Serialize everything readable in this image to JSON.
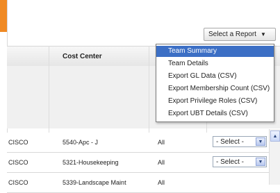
{
  "toolbar": {
    "report_button_label": "Select a Report",
    "caret": "▼"
  },
  "table": {
    "header": {
      "cost_center": "Cost Center"
    },
    "rows": [
      {
        "col1": "CISCO",
        "cost_center": "5540-Apc - J",
        "scope": "All",
        "select_value": "- Select -"
      },
      {
        "col1": "CISCO",
        "cost_center": "5321-Housekeeping",
        "scope": "All",
        "select_value": "- Select -"
      },
      {
        "col1": "CISCO",
        "cost_center": "5339-Landscape Maint",
        "scope": "All"
      }
    ]
  },
  "report_menu": {
    "items": [
      "Team Summary",
      "Team Details",
      "Export GL Data (CSV)",
      "Export Membership Count (CSV)",
      "Export Privilege Roles (CSV)",
      "Export UBT Details (CSV)"
    ],
    "active_index": 0
  },
  "colors": {
    "accent_orange": "#f08a24",
    "menu_highlight": "#3c6fc5"
  },
  "icons": {
    "dropdown_arrow": "chevron-down-icon",
    "scroll_up": "chevron-up-icon"
  }
}
